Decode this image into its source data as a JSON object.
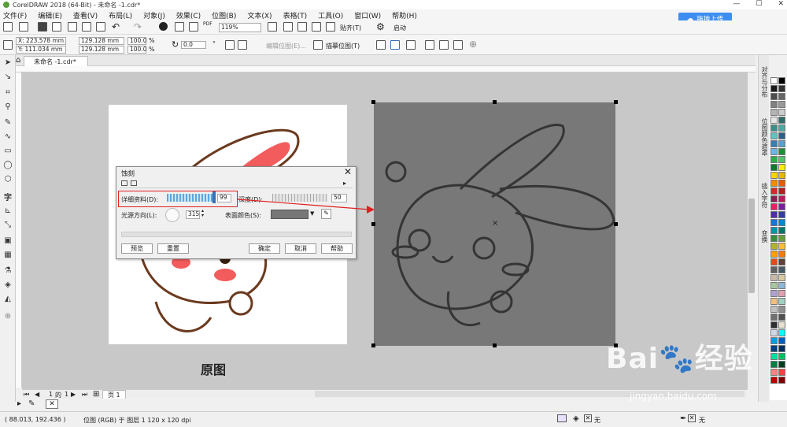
{
  "window": {
    "title": "CorelDRAW 2018 (64-Bit) - 未命名 -1.cdr*",
    "upload_label": "拖拽上传"
  },
  "menu": [
    "文件(F)",
    "编辑(E)",
    "查看(V)",
    "布局(L)",
    "对象(J)",
    "效果(C)",
    "位图(B)",
    "文本(X)",
    "表格(T)",
    "工具(O)",
    "窗口(W)",
    "帮助(H)"
  ],
  "toolbar": {
    "zoom": "119%",
    "snap_label": "贴齐(T)",
    "start_label": "启动",
    "trace_label": "描摹位图(T)",
    "edit_bitmap_label": "编辑位图(E)..."
  },
  "propbar": {
    "x": "X: 223.578 mm",
    "y": "Y: 111.034 mm",
    "w": "129.128 mm",
    "h": "129.128 mm",
    "sx": "100.0",
    "sy": "100.0",
    "pct1": "%",
    "pct2": "%",
    "angle": "0.0",
    "deg": "°"
  },
  "tab": {
    "doc_name": "未命名 -1.cdr*"
  },
  "dialog": {
    "title": "蚀刻",
    "detail_label": "详细资料(D):",
    "detail_value": "99",
    "depth_label": "深度(D):",
    "depth_value": "50",
    "light_label": "光源方向(L):",
    "light_value": "315",
    "surface_label": "表面颜色(S):",
    "preview": "预览",
    "reset": "重置",
    "ok": "确定",
    "cancel": "取消",
    "help": "帮助"
  },
  "canvas": {
    "caption": "原图"
  },
  "dockers": [
    "对齐与分布",
    "位图颜色遮罩",
    "插入字符",
    "变换"
  ],
  "pagenav": {
    "current": "1",
    "of": "的",
    "total": "1",
    "page_tab": "页 1"
  },
  "status": {
    "coords": "( 88.013, 192.436 )",
    "object_info": "位图 (RGB) 于 图层 1 120 x 120 dpi",
    "fill_none": "无",
    "outline_none": "无"
  },
  "watermark": {
    "brand": "Bai",
    "brand2": "经验",
    "url": "jingyan.baidu.com"
  },
  "palette_colors": [
    "#ffffff",
    "#000000",
    "#1a1a1a",
    "#333333",
    "#4d4d4d",
    "#666666",
    "#808080",
    "#999999",
    "#b3b3b3",
    "#cccccc",
    "#e6e6e6",
    "#2a6f6b",
    "#3b8f8a",
    "#4aa9a3",
    "#5fc4bd",
    "#2d5f8a",
    "#3b7db3",
    "#5a9fd4",
    "#6db4e6",
    "#1f8f3a",
    "#2fae4a",
    "#52c46a",
    "#0f7a2a",
    "#ffee00",
    "#f7d500",
    "#e6b800",
    "#f28c00",
    "#e65c00",
    "#d62828",
    "#b31f1f",
    "#8a1f4f",
    "#c2185b",
    "#e91e63",
    "#7b1fa2",
    "#512da8",
    "#303f9f",
    "#1976d2",
    "#0288d1",
    "#0097a7",
    "#00796b",
    "#388e3c",
    "#689f38",
    "#afb42b",
    "#fbc02d",
    "#ffa000",
    "#f57c00",
    "#e64a19",
    "#5d4037",
    "#616161",
    "#455a64",
    "#c9b8a6",
    "#d9c9a0",
    "#a8c8a0",
    "#8fb8d8",
    "#b0a0d0",
    "#e0a0b0",
    "#f0c080",
    "#a0d0c0",
    "#c0c0c0",
    "#909090",
    "#707070",
    "#505050",
    "#303030",
    "#e8e0d0",
    "#d0d8e8",
    "#00ffff",
    "#00a0e0",
    "#0060c0",
    "#004080",
    "#003060",
    "#00e0a0",
    "#00c060",
    "#008040",
    "#004020",
    "#ff8080",
    "#ff4040",
    "#c00000",
    "#800000"
  ]
}
